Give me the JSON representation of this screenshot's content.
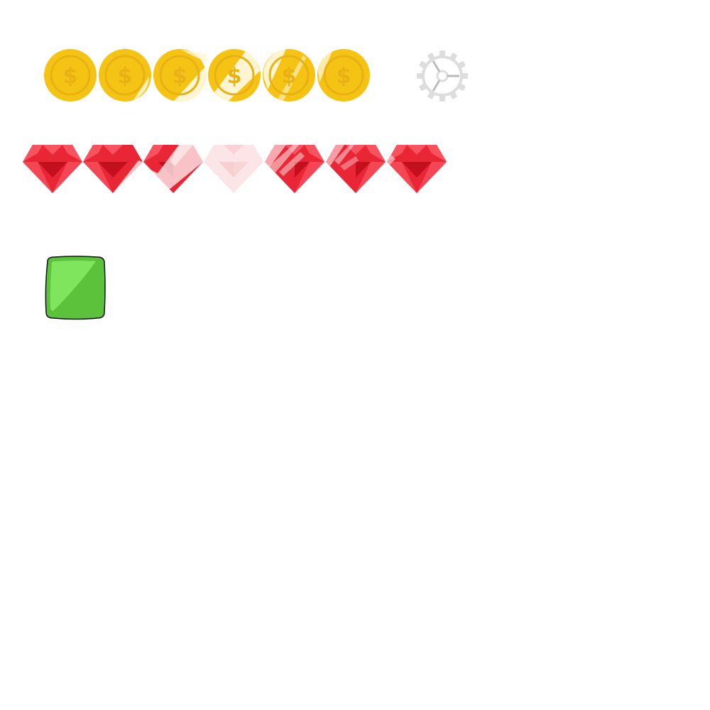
{
  "sprite_sheet": {
    "coin_frames": [
      {
        "label": "coin-frame-1",
        "symbol": "$",
        "sheen": 0
      },
      {
        "label": "coin-frame-2",
        "symbol": "$",
        "sheen": 0.2
      },
      {
        "label": "coin-frame-3",
        "symbol": "$",
        "sheen": 0.45
      },
      {
        "label": "coin-frame-4",
        "symbol": "$",
        "sheen": 0.6
      },
      {
        "label": "coin-frame-5",
        "symbol": "$",
        "sheen": 0.4
      },
      {
        "label": "coin-frame-6",
        "symbol": "$",
        "sheen": 0.15
      }
    ],
    "gem_frames": [
      {
        "label": "gem-frame-1",
        "opacity": 1.0
      },
      {
        "label": "gem-frame-2",
        "opacity": 0.9
      },
      {
        "label": "gem-frame-3",
        "opacity": 0.65
      },
      {
        "label": "gem-frame-4",
        "opacity": 0.12
      },
      {
        "label": "gem-frame-5",
        "opacity": 0.55
      },
      {
        "label": "gem-frame-6",
        "opacity": 0.8
      },
      {
        "label": "gem-frame-7",
        "opacity": 1.0
      }
    ],
    "colors": {
      "coin_outer": "#F5C313",
      "coin_inner": "#E9B114",
      "coin_sheen": "#FFF5D2",
      "gem_light": "#F7525F",
      "gem_mid": "#E92635",
      "gem_dark": "#C2101E",
      "gear": "#DDDDDD",
      "gear_hands": "#BBBBBB",
      "block_fill": "#5CC13B",
      "block_highlight": "#7FE55C",
      "block_outline": "#111111"
    },
    "icons": [
      "dollar-coin-icon",
      "ruby-gem-icon",
      "settings-gear-icon",
      "green-block-tile"
    ]
  }
}
